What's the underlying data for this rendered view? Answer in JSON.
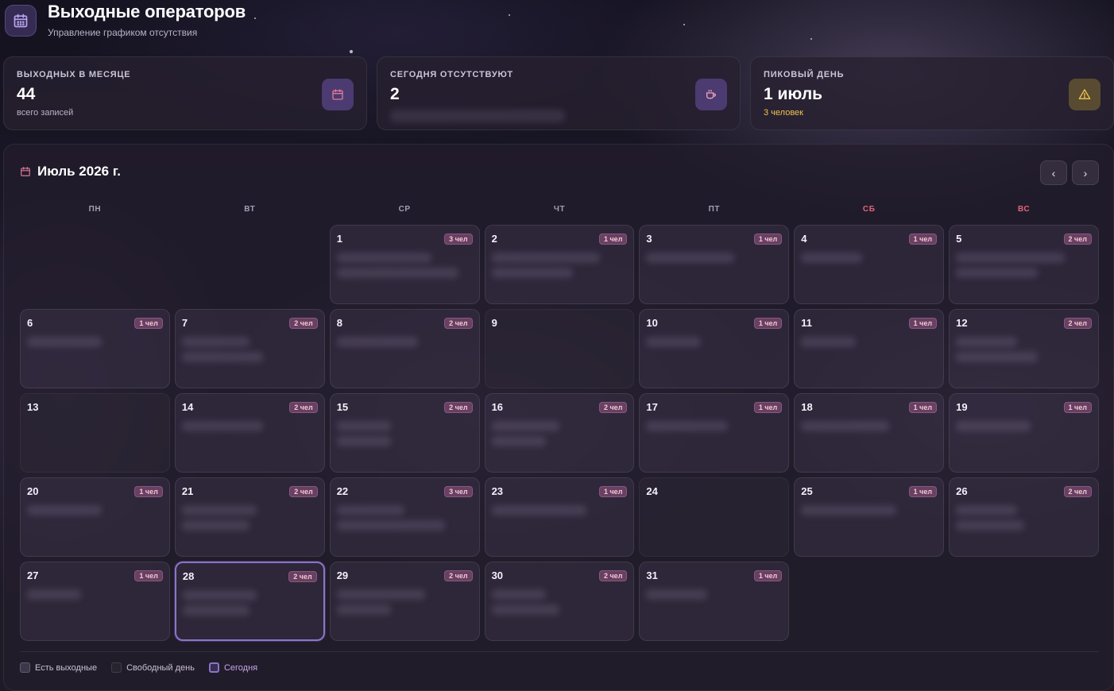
{
  "header": {
    "title": "Выходные операторов",
    "subtitle": "Управление графиком отсутствия"
  },
  "stats": [
    {
      "label": "ВЫХОДНЫХ В МЕСЯЦЕ",
      "value": "44",
      "sub": "всего записей",
      "icon": "calendar-icon"
    },
    {
      "label": "СЕГОДНЯ ОТСУТСТВУЮТ",
      "value": "2",
      "sub": "",
      "icon": "coffee-icon"
    },
    {
      "label": "ПИКОВЫЙ ДЕНЬ",
      "value": "1 июль",
      "sub": "3 человек",
      "icon": "warning-icon"
    }
  ],
  "calendar": {
    "month_label": "Июль 2026 г.",
    "prev_label": "‹",
    "next_label": "›",
    "weekdays": [
      "ПН",
      "ВТ",
      "СР",
      "ЧТ",
      "ПТ",
      "СБ",
      "ВС"
    ],
    "leading_empty": 2,
    "today": 28,
    "days": [
      {
        "num": "1",
        "badge": "3 чел"
      },
      {
        "num": "2",
        "badge": "1 чел"
      },
      {
        "num": "3",
        "badge": "1 чел"
      },
      {
        "num": "4",
        "badge": "1 чел"
      },
      {
        "num": "5",
        "badge": "2 чел"
      },
      {
        "num": "6",
        "badge": "1 чел"
      },
      {
        "num": "7",
        "badge": "2 чел"
      },
      {
        "num": "8",
        "badge": "2 чел"
      },
      {
        "num": "9",
        "badge": ""
      },
      {
        "num": "10",
        "badge": "1 чел"
      },
      {
        "num": "11",
        "badge": "1 чел"
      },
      {
        "num": "12",
        "badge": "2 чел"
      },
      {
        "num": "13",
        "badge": ""
      },
      {
        "num": "14",
        "badge": "2 чел"
      },
      {
        "num": "15",
        "badge": "2 чел"
      },
      {
        "num": "16",
        "badge": "2 чел"
      },
      {
        "num": "17",
        "badge": "1 чел"
      },
      {
        "num": "18",
        "badge": "1 чел"
      },
      {
        "num": "19",
        "badge": "1 чел"
      },
      {
        "num": "20",
        "badge": "1 чел"
      },
      {
        "num": "21",
        "badge": "2 чел"
      },
      {
        "num": "22",
        "badge": "3 чел"
      },
      {
        "num": "23",
        "badge": "1 чел"
      },
      {
        "num": "24",
        "badge": ""
      },
      {
        "num": "25",
        "badge": "1 чел"
      },
      {
        "num": "26",
        "badge": "2 чел"
      },
      {
        "num": "27",
        "badge": "1 чел"
      },
      {
        "num": "28",
        "badge": "2 чел"
      },
      {
        "num": "29",
        "badge": "2 чел"
      },
      {
        "num": "30",
        "badge": "2 чел"
      },
      {
        "num": "31",
        "badge": "1 чел"
      }
    ]
  },
  "legend": {
    "busy": "Есть выходные",
    "free": "Свободный день",
    "today": "Сегодня"
  },
  "colors": {
    "accent": "#8b74c9",
    "weekend": "#e0657b",
    "warning": "#f0c34e"
  }
}
